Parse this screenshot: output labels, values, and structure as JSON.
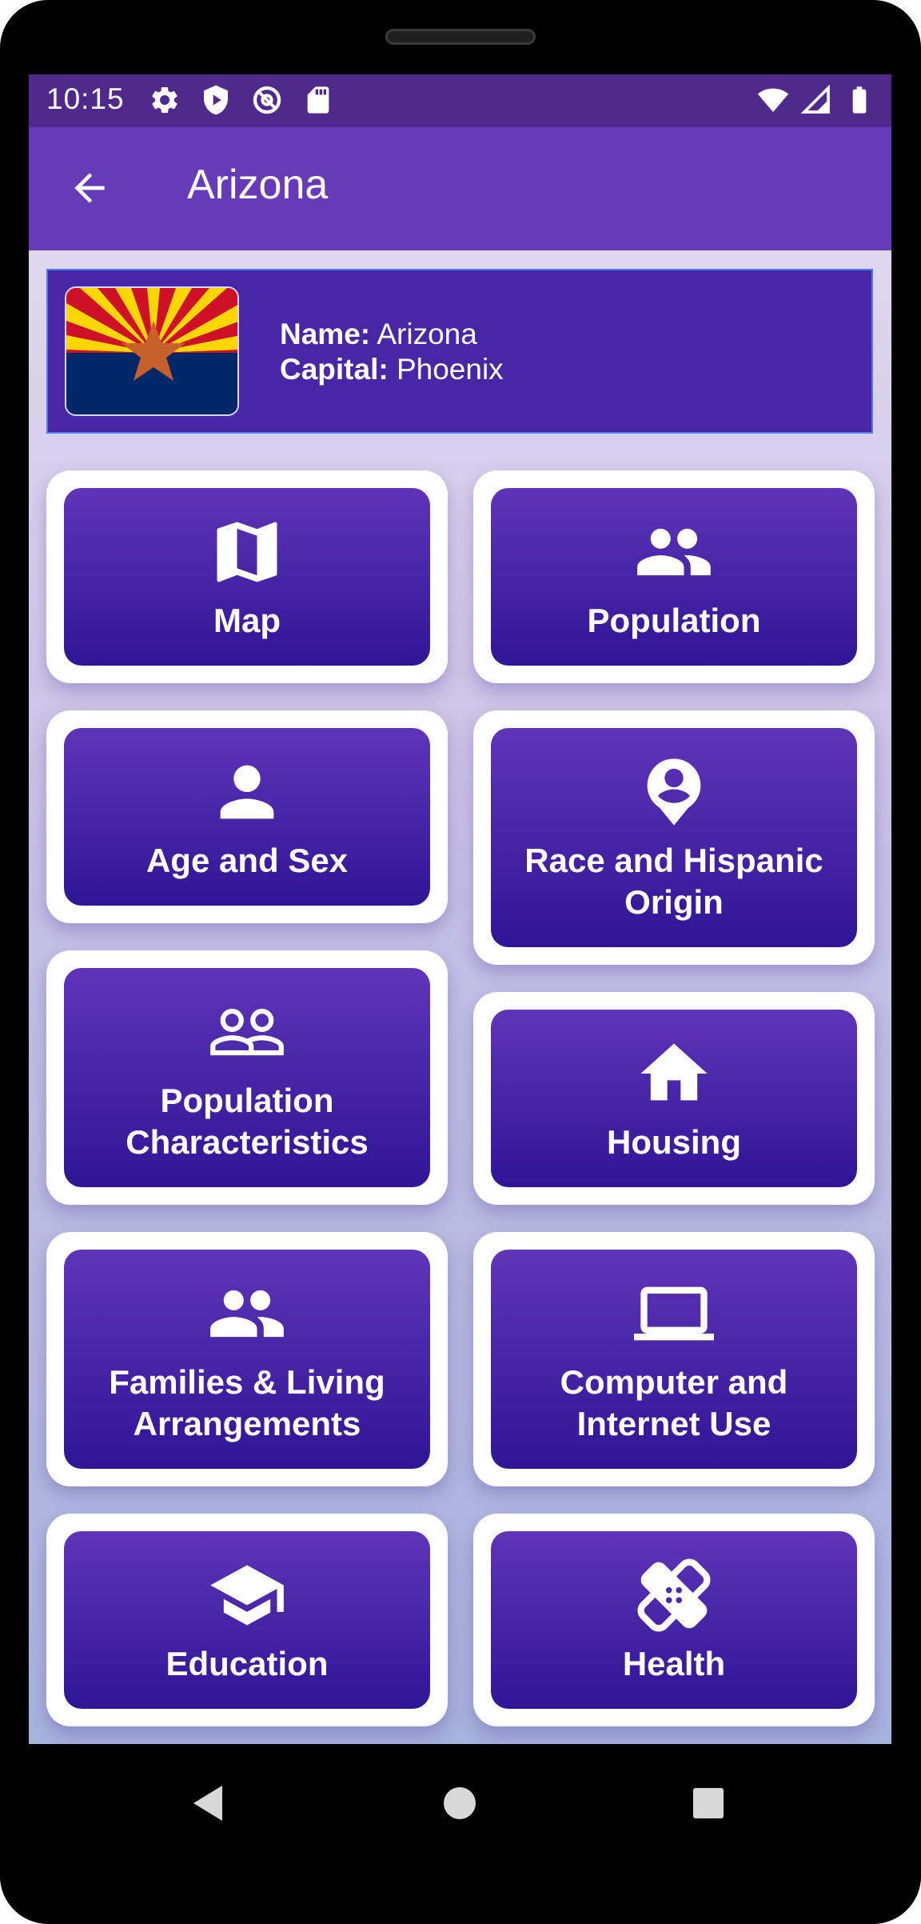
{
  "status_bar": {
    "time": "10:15",
    "left_icons": [
      "gear-icon",
      "shield-play-icon",
      "at-sign-icon",
      "sd-card-icon"
    ],
    "right_icons": [
      "wifi-icon",
      "signal-icon",
      "battery-icon"
    ]
  },
  "app_bar": {
    "title": "Arizona",
    "back_icon": "arrow-back-icon",
    "color": "#673ab7"
  },
  "info_card": {
    "name_label": "Name:",
    "name_value": "Arizona",
    "capital_label": "Capital:",
    "capital_value": "Phoenix",
    "flag": "arizona-flag"
  },
  "tiles": [
    {
      "label": "Map",
      "icon": "map-icon"
    },
    {
      "label": "Population",
      "icon": "people-icon"
    },
    {
      "label": "Age and Sex",
      "icon": "person-icon"
    },
    {
      "label": "Race and Hispanic Origin",
      "icon": "person-pin-icon"
    },
    {
      "label": "Population Characteristics",
      "icon": "people-outline-icon"
    },
    {
      "label": "Housing",
      "icon": "home-icon"
    },
    {
      "label": "Families & Living Arrangements",
      "icon": "people-icon"
    },
    {
      "label": "Computer and Internet Use",
      "icon": "laptop-icon"
    },
    {
      "label": "Education",
      "icon": "school-icon"
    },
    {
      "label": "Health",
      "icon": "healing-icon"
    }
  ],
  "nav_bar": {
    "icons": [
      "back-triangle-icon",
      "home-circle-icon",
      "recents-square-icon"
    ]
  },
  "colors": {
    "status_bar": "#4f2a8c",
    "tile_gradient_top": "#5f35b8",
    "tile_gradient_bottom": "#2f1595",
    "info_card": "#4727a6"
  }
}
